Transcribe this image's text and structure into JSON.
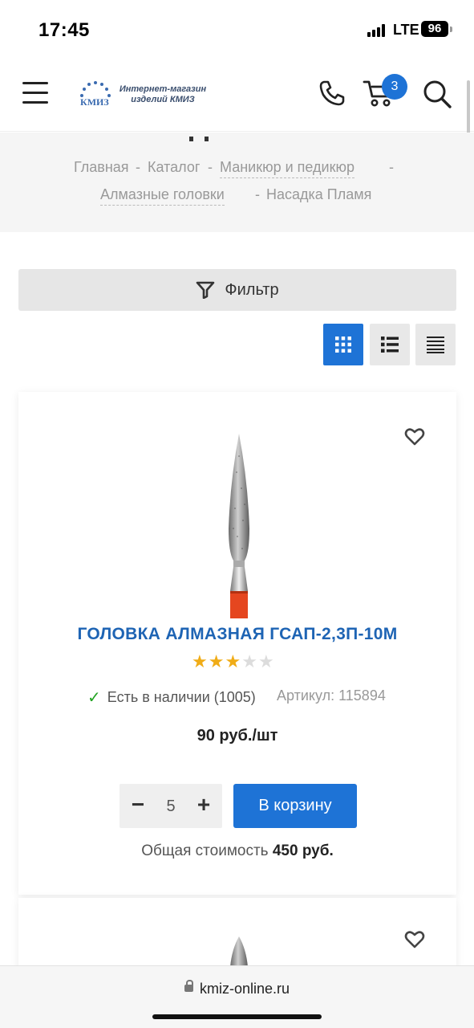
{
  "status_bar": {
    "time": "17:45",
    "network": "LTE",
    "battery": "96"
  },
  "header": {
    "logo_text_line1": "Интернет-магазин",
    "logo_text_line2": "изделий КМИЗ",
    "logo_abbr": "КМИЗ",
    "cart_count": "3",
    "icons": [
      "menu-icon",
      "phone-icon",
      "cart-icon",
      "search-icon"
    ]
  },
  "breadcrumbs": {
    "items": [
      "Главная",
      "Каталог",
      "Маникюр и педикюр",
      "Алмазные головки",
      "Насадка Пламя"
    ],
    "separator": "-"
  },
  "filter": {
    "label": "Фильтр"
  },
  "view_modes": [
    "grid-view-icon",
    "list-view-icon",
    "compact-view-icon"
  ],
  "product": {
    "title": "ГОЛОВКА АЛМАЗНАЯ ГСАП-2,3П-10М",
    "rating": 3,
    "rating_max": 5,
    "stock_text": "Есть в наличии (1005)",
    "sku_text": "Артикул: 115894",
    "price": "90 руб./шт",
    "quantity": "5",
    "qty_minus": "−",
    "qty_plus": "+",
    "cart_button": "В корзину",
    "total_label": "Общая стоимость",
    "total_value": "450 руб."
  },
  "browser": {
    "url": "kmiz-online.ru"
  },
  "colors": {
    "accent": "#1e73d6",
    "title": "#1e64b4",
    "star": "#f0ac17",
    "stock_check": "#22a322"
  }
}
